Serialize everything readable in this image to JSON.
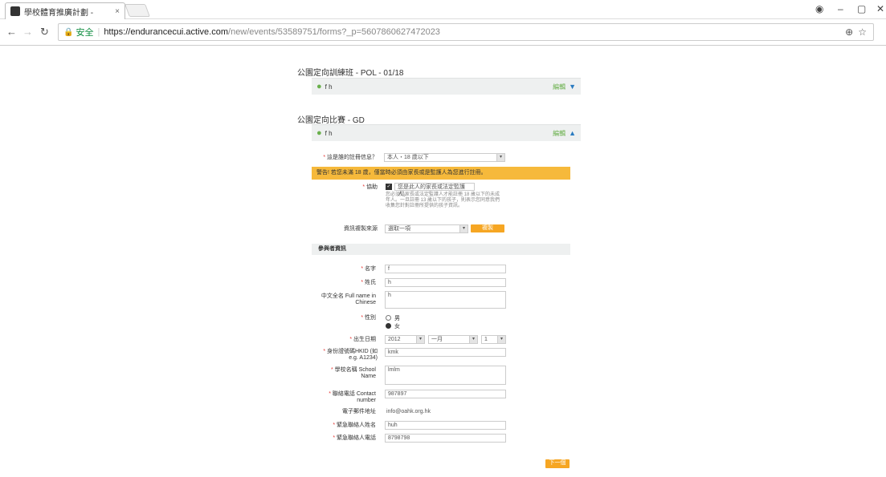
{
  "browser": {
    "tab_title": "學校體育推廣計劃 - ",
    "tab_close": "×",
    "secure_label": "安全",
    "url_host": "https://endurancecui.active.com",
    "url_path": "/new/events/53589751/forms?_p=5607860627472023"
  },
  "panel1": {
    "section_title": "公園定向訓練班 - POL - 01/18",
    "user_name": "f h",
    "edit_label": "編輯",
    "state": "collapsed"
  },
  "panel2": {
    "section_title": "公園定向比賽 - GD",
    "user_name": "f h",
    "edit_label": "編輯",
    "state": "expanded"
  },
  "form": {
    "registrant_label": "這是誰的註冊信息？",
    "registrant_value": "本人・18 歲以下",
    "warning": "警告! 若您未滿 18 歲，僅當時必須由家長或是監護人為您進行註冊。",
    "assist_label": "協助",
    "assist_checkbox_label": "您是此人的家長或法定監護人。",
    "assist_note": "您必須是家長或法定監護人才能註冊 18 歲以下的未成年人。一旦註冊 13 歲以下的孩子，則表示您同意我們收集您針對註冊所提供的孩子資訊。",
    "copy_source_label": "資訊複製來源",
    "copy_source_value": "選取一項",
    "copy_button": "複製",
    "participant_section": "參與者資訊",
    "first_name_label": "名字",
    "first_name_value": "f",
    "last_name_label": "姓氏",
    "last_name_value": "h",
    "chinese_name_label": "中文全名 Full name in Chinese",
    "chinese_name_value": "h",
    "gender_label": "性別",
    "gender_options": [
      "男",
      "女"
    ],
    "gender_selected": "女",
    "dob_label": "出生日期",
    "dob_year": "2012",
    "dob_month": "一月",
    "dob_day": "1",
    "hkid_label": "身份證號碼HKID (如 e.g. A1234)",
    "hkid_value": "kmk",
    "school_label": "學校名稱 School Name",
    "school_value": "lmlm",
    "contact_label": "聯絡電話 Contact number",
    "contact_value": "987897",
    "email_label": "電子郵件地址",
    "email_value": "info@oahk.org.hk",
    "emergency_name_label": "緊急聯絡人姓名",
    "emergency_name_value": "huh",
    "emergency_phone_label": "緊急聯絡人電話",
    "emergency_phone_value": "8798798",
    "next_button": "下一個"
  },
  "colors": {
    "accent": "#f6a623",
    "warning": "#f6b93b",
    "secure": "#0a8a3c",
    "user_icon": "#6ab04c"
  }
}
